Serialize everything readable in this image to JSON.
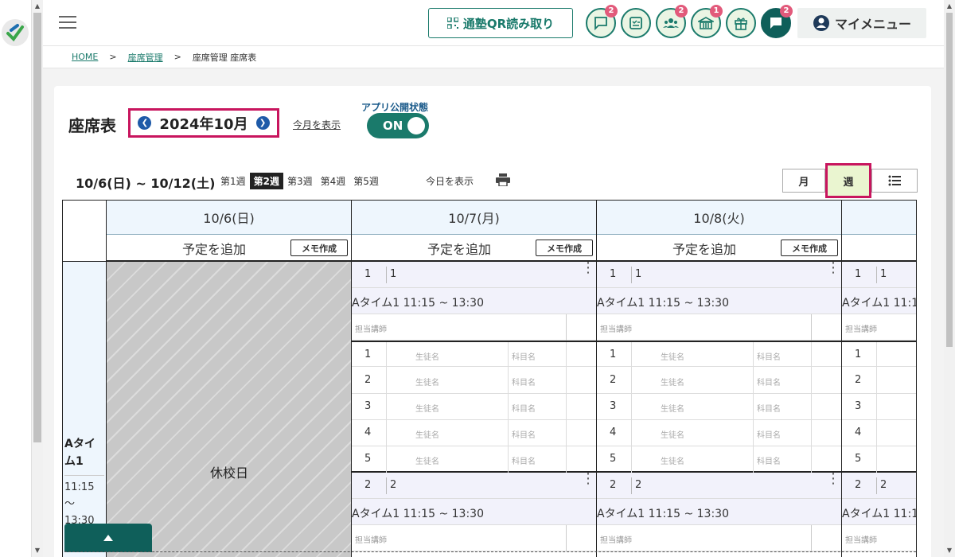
{
  "header": {
    "qr_label": "通塾QR読み取り",
    "badges": {
      "chat": "2",
      "parents": "2",
      "school": "1",
      "messages": "2"
    },
    "mymenu_label": "マイメニュー"
  },
  "breadcrumb": {
    "home": "HOME",
    "seat_mgmt": "座席管理",
    "current": "座席管理 座席表",
    "sep": ">"
  },
  "page": {
    "title": "座席表",
    "month": "2024年10月",
    "this_month_link": "今月を表示",
    "app_status_label": "アプリ公開状態",
    "toggle_label": "ON"
  },
  "week_bar": {
    "range": "10/6(日) ~ 10/12(土)",
    "tabs": [
      "第1週",
      "第2週",
      "第3週",
      "第4週",
      "第5週"
    ],
    "active_tab": "第2週",
    "today_link": "今日を表示"
  },
  "view_buttons": {
    "month": "月",
    "week": "週"
  },
  "calendar": {
    "days": [
      {
        "date": "10/6(日)",
        "add": "予定を追加",
        "memo": "メモ作成"
      },
      {
        "date": "10/7(月)",
        "add": "予定を追加",
        "memo": "メモ作成"
      },
      {
        "date": "10/8(火)",
        "add": "予定を追加",
        "memo": "メモ作成"
      }
    ],
    "holiday_label": "休校日",
    "slot": {
      "name": "Aタイム1",
      "time": "11:15～13:30"
    },
    "group1": {
      "num": "1",
      "name": "1"
    },
    "group2": {
      "num": "2",
      "name": "2"
    },
    "lesson_text": "Aタイム1 11:15 ~ 13:30",
    "lesson_text_cut": "Aタイム1 11:1",
    "teacher_label": "担当講師",
    "student_label": "生徒名",
    "subject_label": "科目名",
    "seat_numbers": [
      "1",
      "2",
      "3",
      "4",
      "5"
    ]
  }
}
